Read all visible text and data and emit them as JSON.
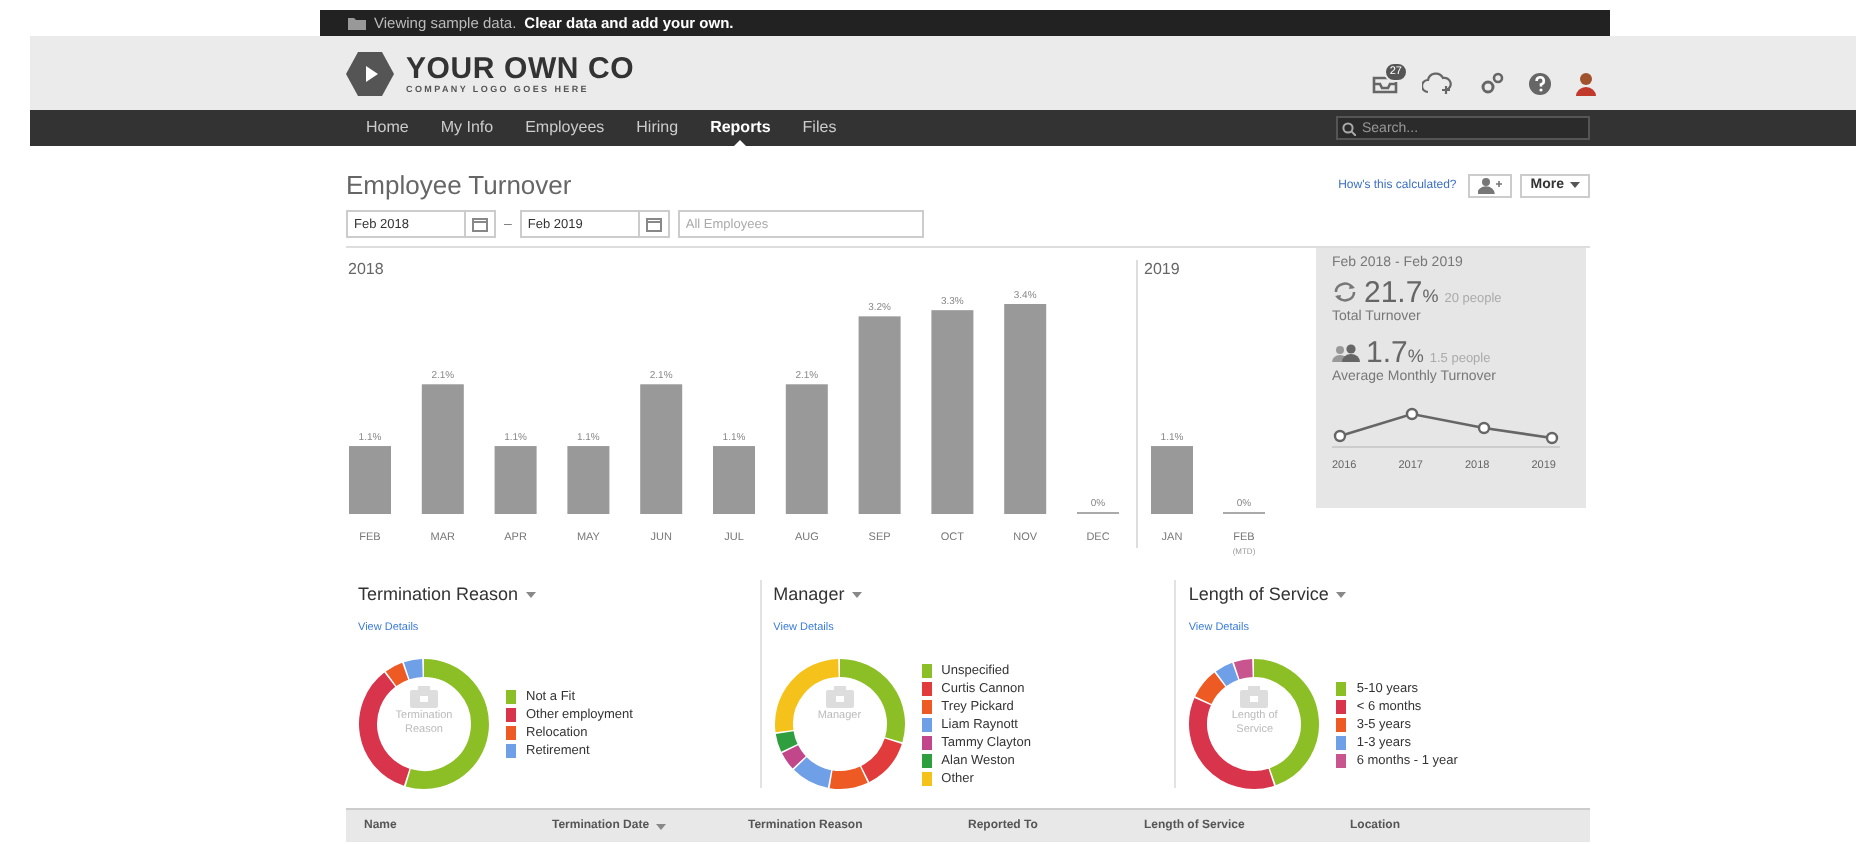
{
  "banner": {
    "text": "Viewing sample data.",
    "link": "Clear data and add your own."
  },
  "logo": {
    "name": "YOUR OWN CO",
    "tagline": "COMPANY LOGO GOES HERE"
  },
  "header": {
    "inbox_badge": "27"
  },
  "nav": {
    "items": [
      {
        "label": "Home",
        "selected": false
      },
      {
        "label": "My Info",
        "selected": false
      },
      {
        "label": "Employees",
        "selected": false
      },
      {
        "label": "Hiring",
        "selected": false
      },
      {
        "label": "Reports",
        "selected": true
      },
      {
        "label": "Files",
        "selected": false
      }
    ],
    "search": {
      "placeholder": "Search..."
    }
  },
  "report": {
    "title": "Employee Turnover",
    "help_link": "How's this calculated?",
    "more_button": "More",
    "from_date": "Feb 2018",
    "separator": "–",
    "to_date": "Feb 2019",
    "employee_filter": {
      "placeholder": "All Employees"
    }
  },
  "charts": [
    {
      "year": "2018",
      "chart_data": {
        "type": "bar",
        "categories": [
          "FEB",
          "MAR",
          "APR",
          "MAY",
          "JUN",
          "JUL",
          "AUG",
          "SEP",
          "OCT",
          "NOV",
          "DEC"
        ],
        "values": [
          1.1,
          2.1,
          1.1,
          1.1,
          2.1,
          1.1,
          2.1,
          3.2,
          3.3,
          3.4,
          0
        ],
        "value_labels": [
          "1.1%",
          "2.1%",
          "1.1%",
          "1.1%",
          "2.1%",
          "1.1%",
          "2.1%",
          "3.2%",
          "3.3%",
          "3.4%",
          "0%"
        ]
      }
    },
    {
      "year": "2019",
      "note": "(MTD)",
      "chart_data": {
        "type": "bar",
        "categories": [
          "JAN",
          "FEB"
        ],
        "values": [
          1.1,
          0
        ],
        "value_labels": [
          "1.1%",
          "0%"
        ]
      }
    }
  ],
  "stats": {
    "period": "Feb 2018 - Feb 2019",
    "total": {
      "value": "21.7",
      "unit": "%",
      "people": "20 people",
      "label": "Total Turnover"
    },
    "average": {
      "value": "1.7",
      "unit": "%",
      "people": "1.5 people",
      "label": "Average Monthly Turnover"
    },
    "trend_years": [
      "2016",
      "2017",
      "2018",
      "2019"
    ]
  },
  "breakdowns": [
    {
      "title": "Termination Reason",
      "link": "View Details",
      "center_label": "Termination Reason",
      "legend": [
        {
          "label": "Not a Fit",
          "color": "#8cbf26"
        },
        {
          "label": "Other employment",
          "color": "#d8344c"
        },
        {
          "label": "Relocation",
          "color": "#ee5a24"
        },
        {
          "label": "Retirement",
          "color": "#6f9fe6"
        }
      ]
    },
    {
      "title": "Manager",
      "link": "View Details",
      "center_label": "Manager",
      "legend": [
        {
          "label": "Unspecified",
          "color": "#8cbf26"
        },
        {
          "label": "Curtis Cannon",
          "color": "#e23b3b"
        },
        {
          "label": "Trey Pickard",
          "color": "#ee5a24"
        },
        {
          "label": "Liam Raynott",
          "color": "#6f9fe6"
        },
        {
          "label": "Tammy Clayton",
          "color": "#c2478a"
        },
        {
          "label": "Alan Weston",
          "color": "#2e9e3e"
        },
        {
          "label": "Other",
          "color": "#f5c21b"
        }
      ]
    },
    {
      "title": "Length of Service",
      "link": "View Details",
      "center_label": "Length of Service",
      "legend": [
        {
          "label": "5-10 years",
          "color": "#8cbf26"
        },
        {
          "label": "< 6 months",
          "color": "#d8344c"
        },
        {
          "label": "3-5 years",
          "color": "#ee5a24"
        },
        {
          "label": "1-3 years",
          "color": "#6f9fe6"
        },
        {
          "label": "6 months - 1 year",
          "color": "#c9558f"
        }
      ]
    }
  ],
  "table": {
    "columns": [
      {
        "label": "Name",
        "sorted": false
      },
      {
        "label": "Termination Date",
        "sorted": true
      },
      {
        "label": "Termination Reason",
        "sorted": false
      },
      {
        "label": "Reported To",
        "sorted": false
      },
      {
        "label": "Length of Service",
        "sorted": false
      },
      {
        "label": "Location",
        "sorted": false
      }
    ]
  }
}
